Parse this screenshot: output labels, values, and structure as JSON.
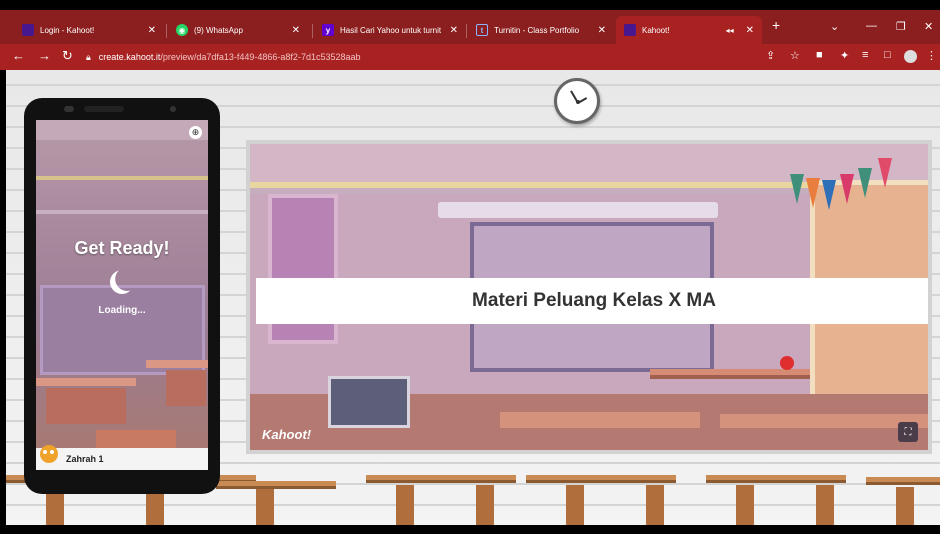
{
  "browser": {
    "tabs": [
      {
        "label": "Login - Kahoot!",
        "favicon": "kahoot-icon",
        "color": "#46178f"
      },
      {
        "label": "(9) WhatsApp",
        "favicon": "whatsapp-icon",
        "color": "#25d366"
      },
      {
        "label": "Hasil Cari Yahoo untuk turnit",
        "favicon": "yahoo-icon",
        "color": "#6001d2"
      },
      {
        "label": "Turnitin - Class Portfolio",
        "favicon": "turnitin-icon",
        "color": "#2b4f9e"
      },
      {
        "label": "Kahoot!",
        "favicon": "kahoot-icon",
        "color": "#46178f"
      }
    ],
    "new_tab": "+",
    "url_host": "create.kahoot.it",
    "url_path": "/preview/da7dfa13-f449-4866-a8f2-7d1c53528aab",
    "accent": "#a82222"
  },
  "phone": {
    "get_ready": "Get Ready!",
    "loading": "Loading...",
    "player_name": "Zahrah 1"
  },
  "slide": {
    "title": "Materi Peluang Kelas X MA",
    "logo": "Kahoot!"
  }
}
